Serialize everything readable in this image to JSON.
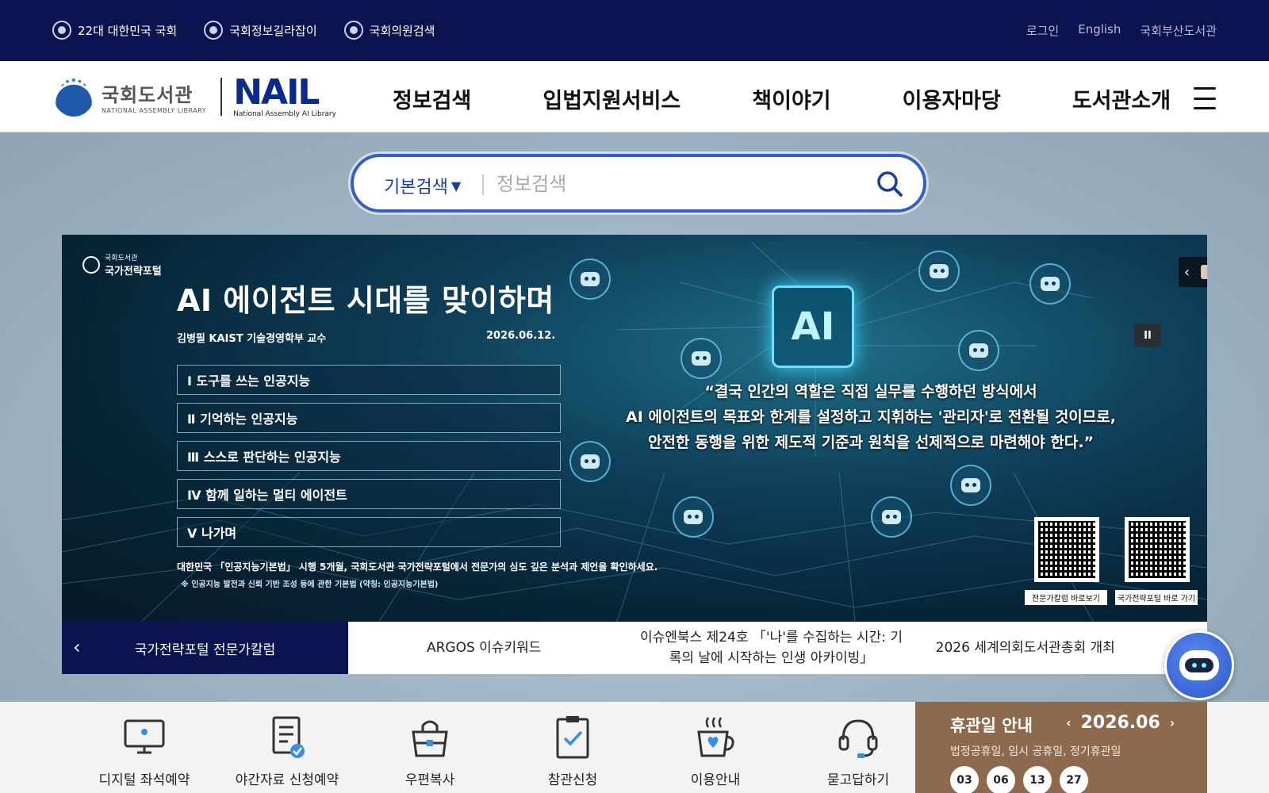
{
  "topbar": {
    "links": [
      {
        "label": "22대 대한민국 국회",
        "icon": "assembly-emblem-icon"
      },
      {
        "label": "국회정보길라잡이",
        "icon": "assembly-emblem-icon"
      },
      {
        "label": "국회의원검색",
        "icon": "assembly-emblem-icon"
      }
    ],
    "util": [
      "로그인",
      "English",
      "국회부산도서관"
    ]
  },
  "header": {
    "logo_ko": "국회도서관",
    "logo_en": "NATIONAL ASSEMBLY LIBRARY",
    "nail_word": "NAIL",
    "nail_sub": "National Assembly AI Library",
    "nav": [
      "정보검색",
      "입법지원서비스",
      "책이야기",
      "이용자마당",
      "도서관소개"
    ]
  },
  "search": {
    "type_label": "기본검색",
    "placeholder": "정보검색",
    "value": ""
  },
  "banner": {
    "portal_small": "국회도서관",
    "portal_name": "국가전략포털",
    "title": "AI 에이전트 시대를 맞이하며",
    "author": "김병필 KAIST 기술경영학부 교수",
    "date": "2026.06.12.",
    "toc": [
      "Ⅰ 도구를 쓰는 인공지능",
      "Ⅱ 기억하는 인공지능",
      "Ⅲ 스스로 판단하는 인공지능",
      "Ⅳ 함께 일하는 멀티 에이전트",
      "Ⅴ 나가며"
    ],
    "chip_label": "AI",
    "quote": [
      "“결국 인간의 역할은 직접 실무를 수행하던 방식에서",
      "AI 에이전트의 목표와 한계를 설정하고 지휘하는 '관리자'로 전환될 것이므로,",
      "안전한 동행을 위한 제도적 기준과 원칙을 선제적으로 마련해야 한다.”"
    ],
    "note": "대한민국 「인공지능기본법」 시행 5개월, 국회도서관 국가전략포털에서 전문가의 심도 깊은 분석과 제언을 확인하세요.",
    "footnote": "※ 인공지능 발전과 신뢰 기반 조성 등에 관한 기본법 (약칭: 인공지능기본법)",
    "qr_labels": [
      "전문가칼럼 바로보기",
      "국가전략포털 바로 가기"
    ]
  },
  "tabs": {
    "active": "국가전략포털 전문가칼럼",
    "items": [
      "ARGOS 이슈키워드",
      "이슈엔북스 제24호 「'나'를 수집하는 시간: 기록의 날에 시작하는 인생 아카이빙」",
      "2026 세계의회도서관총회 개최"
    ]
  },
  "quickmenu": [
    {
      "label": "디지털 좌석예약",
      "icon": "monitor-icon"
    },
    {
      "label": "야간자료 신청예약",
      "icon": "document-check-icon"
    },
    {
      "label": "우편복사",
      "icon": "bag-icon"
    },
    {
      "label": "참관신청",
      "icon": "clipboard-check-icon"
    },
    {
      "label": "이용안내",
      "icon": "coffee-cup-icon"
    },
    {
      "label": "묻고답하기",
      "icon": "headset-icon"
    }
  ],
  "holiday": {
    "title": "휴관일 안내",
    "month": "2026.06",
    "desc": "법정공휴일, 임시 공휴일, 정기휴관일",
    "dates": [
      "03",
      "06",
      "13",
      "27"
    ]
  },
  "colors": {
    "topbar_bg": "#0b1450",
    "search_border": "#3460c4",
    "holiday_bg": "#8d6a4e"
  }
}
